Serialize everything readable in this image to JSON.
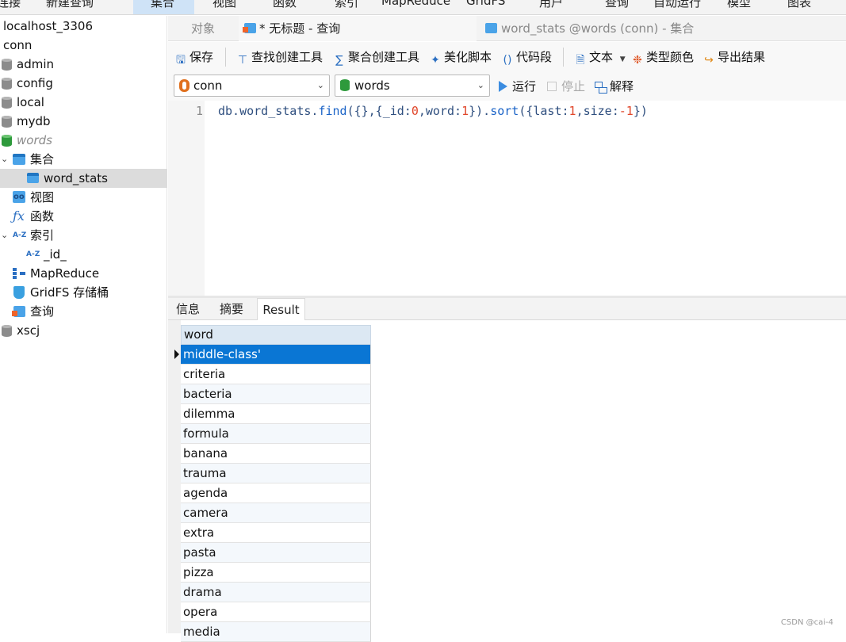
{
  "menubar": {
    "items": [
      "连接",
      "新建查询",
      "集合",
      "视图",
      "函数",
      "索引",
      "MapReduce",
      "GridFS",
      "用户",
      "查询",
      "自动运行",
      "模型",
      "图表"
    ]
  },
  "sidebar": {
    "connection": "localhost_3306",
    "conn": "conn",
    "databases": [
      "admin",
      "config",
      "local",
      "mydb",
      "words"
    ],
    "collections_label": "集合",
    "collection_item": "word_stats",
    "views_label": "视图",
    "functions_label": "函数",
    "indexes_label": "索引",
    "index_item": "_id_",
    "mapreduce_label": "MapReduce",
    "gridfs_label": "GridFS 存储桶",
    "queries_label": "查询",
    "other_db": "xscj"
  },
  "tabs": {
    "objects": "对象",
    "query": "* 无标题 - 查询",
    "collection": "word_stats @words (conn) - 集合"
  },
  "toolbar": {
    "save": "保存",
    "find_builder": "查找创建工具",
    "aggregate_builder": "聚合创建工具",
    "beautify": "美化脚本",
    "snippet": "代码段",
    "text": "文本",
    "type_color": "类型颜色",
    "export": "导出结果"
  },
  "selectors": {
    "connection": "conn",
    "database": "words"
  },
  "actions": {
    "run": "运行",
    "stop": "停止",
    "explain": "解释"
  },
  "editor": {
    "line_number": "1",
    "code": {
      "p1": "db.word_stats.",
      "fn1": "find",
      "p2": "({},{_id:",
      "n1": "0",
      "p3": ",word:",
      "n2": "1",
      "p4": "}).",
      "fn2": "sort",
      "p5": "({last:",
      "n3": "1",
      "p6": ",size:",
      "n4": "-1",
      "p7": "})"
    }
  },
  "result_tabs": {
    "info": "信息",
    "summary": "摘要",
    "result": "Result"
  },
  "result": {
    "column": "word",
    "rows": [
      "middle-class'",
      "criteria",
      "bacteria",
      "dilemma",
      "formula",
      "banana",
      "trauma",
      "agenda",
      "camera",
      "extra",
      "pasta",
      "pizza",
      "drama",
      "opera",
      "media"
    ]
  },
  "watermark": "CSDN @cai-4"
}
